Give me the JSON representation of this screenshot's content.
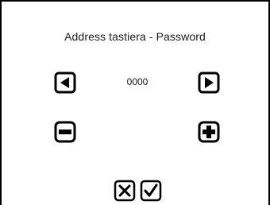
{
  "dialog": {
    "title": "Address tastiera - Password",
    "value": "0000"
  },
  "icons": {
    "left": "arrow-left-icon",
    "right": "arrow-right-icon",
    "minus": "minus-icon",
    "plus": "plus-icon",
    "cancel": "close-x-icon",
    "confirm": "checkmark-icon"
  }
}
